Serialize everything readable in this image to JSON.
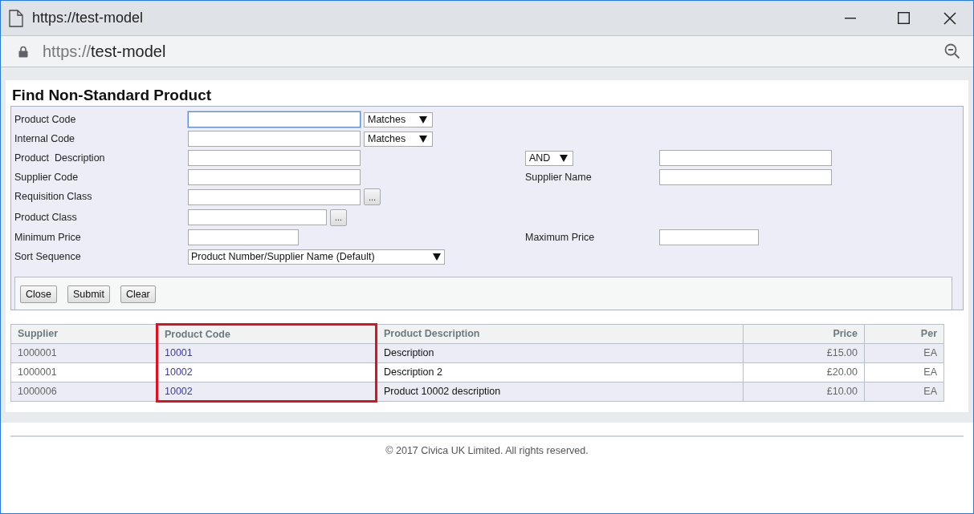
{
  "window": {
    "title": "https://test-model"
  },
  "address_bar": {
    "scheme": "https://",
    "host": "test-model"
  },
  "page": {
    "title": "Find Non-Standard Product"
  },
  "form": {
    "rows": [
      {
        "label": "Product Code",
        "field": {
          "kind": "text",
          "focused": true
        },
        "operator": "Matches"
      },
      {
        "label": "Internal Code",
        "field": {
          "kind": "text",
          "focused": false
        },
        "operator": "Matches"
      },
      {
        "label": "Product  Description",
        "field": {
          "kind": "text",
          "focused": false
        },
        "right_operator": "AND",
        "right_field": {
          "kind": "text",
          "focused": false
        }
      },
      {
        "label": "Supplier Code",
        "field": {
          "kind": "text",
          "focused": false
        },
        "right_label": "Supplier Name",
        "right_field": {
          "kind": "text",
          "focused": false
        }
      },
      {
        "label": "Requisition Class",
        "field": {
          "kind": "lookup",
          "focused": false
        },
        "lookup_button": "..."
      },
      {
        "label": "Product Class",
        "field": {
          "kind": "class_lookup",
          "focused": false
        },
        "lookup_button": "..."
      },
      {
        "label": "Minimum Price",
        "field": {
          "kind": "price",
          "focused": false
        },
        "right_label": "Maximum Price",
        "right_field": {
          "kind": "price",
          "focused": false
        }
      },
      {
        "label": "Sort Sequence",
        "field": {
          "kind": "select",
          "value": "Product Number/Supplier Name (Default)"
        }
      }
    ],
    "buttons": [
      "Close",
      "Submit",
      "Clear"
    ]
  },
  "table": {
    "columns": [
      {
        "label": "Supplier",
        "highlighted": false
      },
      {
        "label": "Product Code",
        "highlighted": true
      },
      {
        "label": "Product Description",
        "highlighted": false
      },
      {
        "label": "Price",
        "highlighted": false
      },
      {
        "label": "Per",
        "highlighted": false
      }
    ],
    "rows": [
      [
        "1000001",
        "10001",
        "Description",
        "£15.00",
        "EA"
      ],
      [
        "1000001",
        "10002",
        "Description 2",
        "£20.00",
        "EA"
      ],
      [
        "1000006",
        "10002",
        "Product 10002 description",
        "£10.00",
        "EA"
      ]
    ]
  },
  "footer": "© 2017 Civica UK Limited. All rights reserved."
}
